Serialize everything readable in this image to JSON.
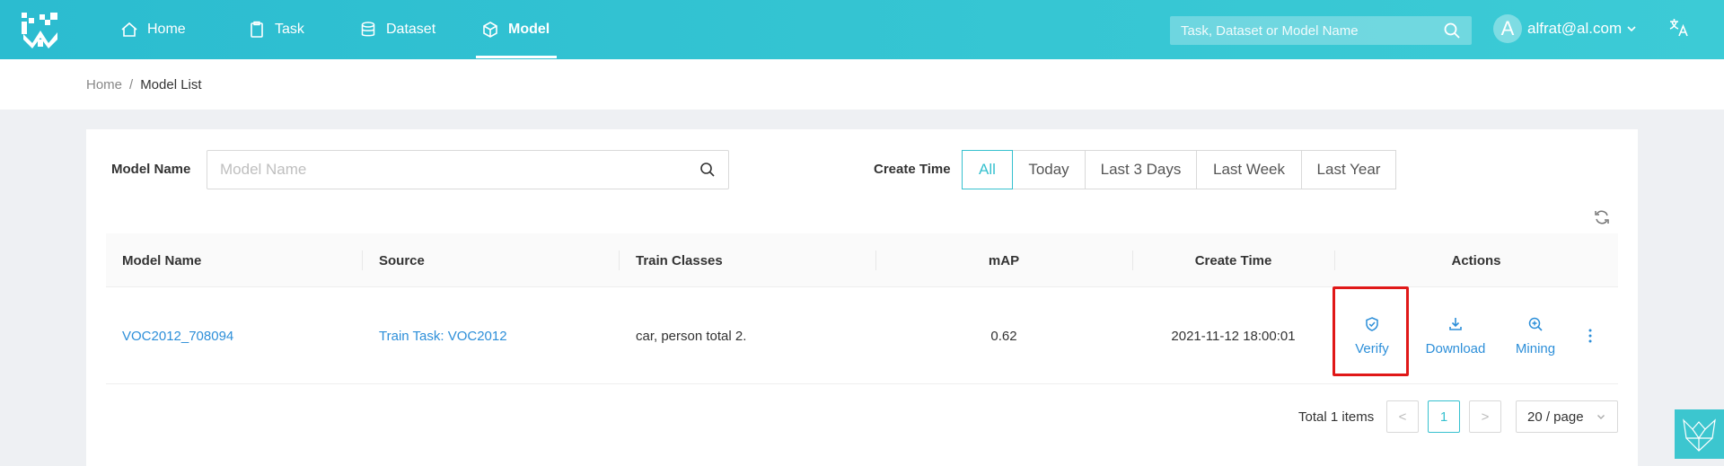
{
  "header": {
    "nav": [
      {
        "label": "Home",
        "icon": "home-icon"
      },
      {
        "label": "Task",
        "icon": "task-icon"
      },
      {
        "label": "Dataset",
        "icon": "database-icon"
      },
      {
        "label": "Model",
        "icon": "cube-icon",
        "active": true
      }
    ],
    "search_placeholder": "Task, Dataset or Model Name",
    "user": {
      "avatar_letter": "A",
      "email": "alfrat@al.com"
    }
  },
  "breadcrumb": {
    "home": "Home",
    "separator": "/",
    "current": "Model List"
  },
  "filters": {
    "name_label": "Model Name",
    "name_placeholder": "Model Name",
    "time_label": "Create Time",
    "time_options": [
      "All",
      "Today",
      "Last 3 Days",
      "Last Week",
      "Last Year"
    ],
    "time_selected": "All"
  },
  "table": {
    "columns": [
      "Model Name",
      "Source",
      "Train Classes",
      "mAP",
      "Create Time",
      "Actions"
    ],
    "rows": [
      {
        "name": "VOC2012_708094",
        "source": "Train Task: VOC2012",
        "classes": "car, person total 2.",
        "map": "0.62",
        "create_time": "2021-11-12 18:00:01",
        "actions": [
          "Verify",
          "Download",
          "Mining"
        ]
      }
    ]
  },
  "pagination": {
    "total_text": "Total 1 items",
    "current_page": "1",
    "prev": "<",
    "next": ">",
    "page_size": "20 / page"
  },
  "colors": {
    "accent": "#36c1cf",
    "link": "#2d8fd9",
    "highlight": "#e01818"
  }
}
